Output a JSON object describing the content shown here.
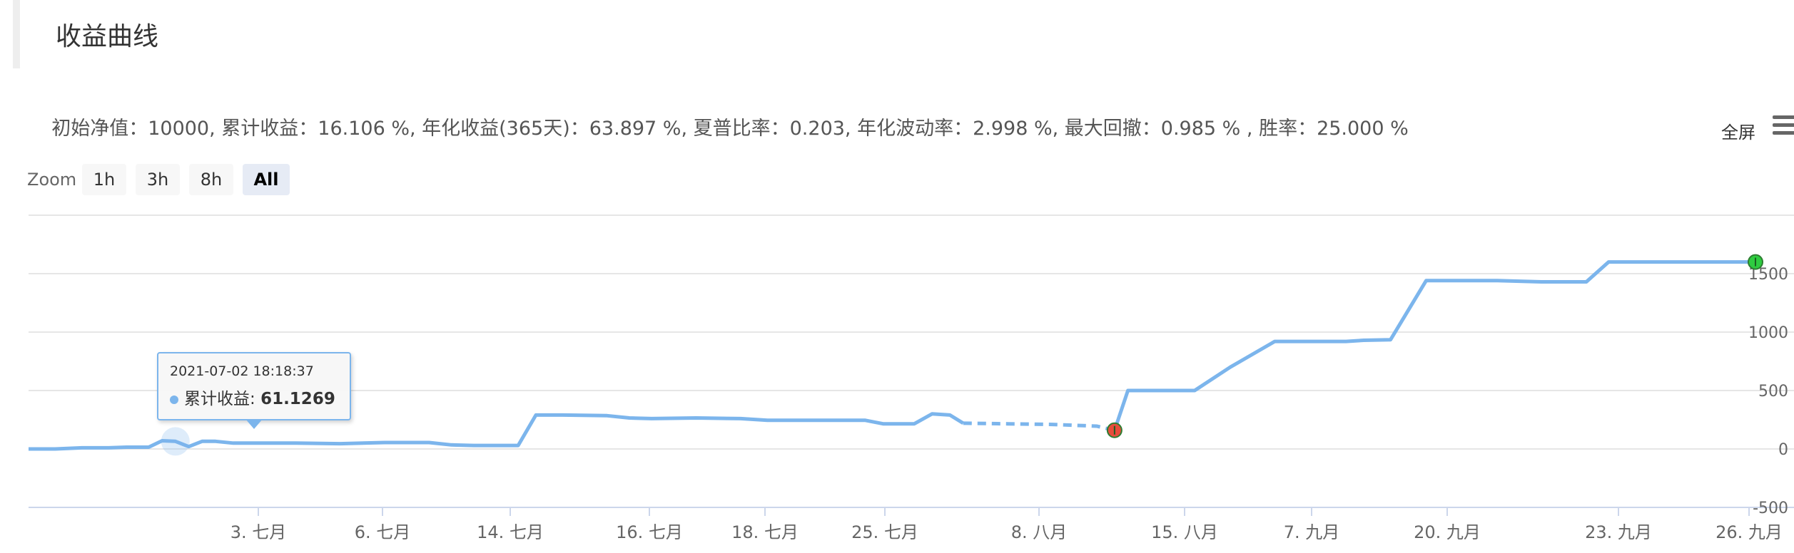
{
  "panel": {
    "title": "收益曲线"
  },
  "stats_text": "初始净值：10000, 累计收益：16.106 %, 年化收益(365天)：63.897 %, 夏普比率：0.203, 年化波动率：2.998 %, 最大回撤：0.985 % , 胜率：25.000 %",
  "toolbar": {
    "fullscreen_label": "全屏",
    "menu_icon": "hamburger-menu-icon"
  },
  "zoom": {
    "label": "Zoom",
    "buttons": [
      "1h",
      "3h",
      "8h",
      "All"
    ],
    "selected": "All"
  },
  "tooltip": {
    "date": "2021-07-02 18:18:37",
    "series": "累计收益",
    "value": "61.1269"
  },
  "colors": {
    "line": "#7cb5ec",
    "buy_marker": "#2ecc40",
    "sell_marker": "#e74c3c",
    "grid": "#e6e6e6"
  },
  "chart_data": {
    "type": "line",
    "x_ticks": [
      "3. 七月",
      "6. 七月",
      "14. 七月",
      "16. 七月",
      "18. 七月",
      "25. 七月",
      "8. 八月",
      "15. 八月",
      "7. 九月",
      "20. 九月",
      "23. 九月",
      "26. 九月"
    ],
    "y_ticks": [
      -500,
      0,
      500,
      1000,
      1500
    ],
    "ylim": [
      -500,
      2000
    ],
    "grid": true,
    "legend": "none",
    "series": [
      {
        "values": [
          [
            0,
            0
          ],
          [
            0.3,
            0
          ],
          [
            0.6,
            10
          ],
          [
            0.9,
            10
          ],
          [
            1.1,
            15
          ],
          [
            1.35,
            15
          ],
          [
            1.5,
            70
          ],
          [
            1.65,
            65
          ],
          [
            1.8,
            20
          ],
          [
            1.95,
            65
          ],
          [
            2.1,
            65
          ],
          [
            2.3,
            50
          ],
          [
            3,
            50
          ],
          [
            3.5,
            45
          ],
          [
            4,
            55
          ],
          [
            4.5,
            55
          ],
          [
            4.75,
            35
          ],
          [
            5,
            30
          ],
          [
            5.5,
            30
          ],
          [
            5.7,
            290
          ],
          [
            6,
            290
          ],
          [
            6.5,
            285
          ],
          [
            6.75,
            265
          ],
          [
            7,
            260
          ],
          [
            7.5,
            265
          ],
          [
            8,
            260
          ],
          [
            8.3,
            245
          ],
          [
            8.5,
            245
          ],
          [
            9,
            245
          ],
          [
            9.4,
            245
          ],
          [
            9.6,
            215
          ],
          [
            9.95,
            215
          ],
          [
            10.15,
            300
          ],
          [
            10.35,
            290
          ],
          [
            10.5,
            220
          ],
          [
            11,
            215
          ],
          [
            11.5,
            210
          ],
          [
            12,
            195
          ],
          [
            12.2,
            160
          ],
          [
            12.35,
            500
          ],
          [
            12.85,
            500
          ],
          [
            13.1,
            500
          ],
          [
            13.5,
            700
          ],
          [
            14,
            920
          ],
          [
            14.4,
            920
          ],
          [
            14.8,
            920
          ],
          [
            15,
            930
          ],
          [
            15.3,
            935
          ],
          [
            15.7,
            1440
          ],
          [
            16,
            1440
          ],
          [
            16.5,
            1440
          ],
          [
            17,
            1430
          ],
          [
            17.5,
            1430
          ],
          [
            17.75,
            1600
          ],
          [
            18,
            1600
          ],
          [
            18.5,
            1600
          ],
          [
            19,
            1600
          ],
          [
            19.4,
            1600
          ]
        ]
      }
    ],
    "dashed_segment": [
      10.5,
      12.2
    ],
    "markers": [
      {
        "kind": "sell",
        "x": 12.2,
        "y": 160
      },
      {
        "kind": "buy",
        "x": 19.4,
        "y": 1600
      }
    ],
    "hover_point": {
      "x": 1.65,
      "y": 65
    }
  }
}
